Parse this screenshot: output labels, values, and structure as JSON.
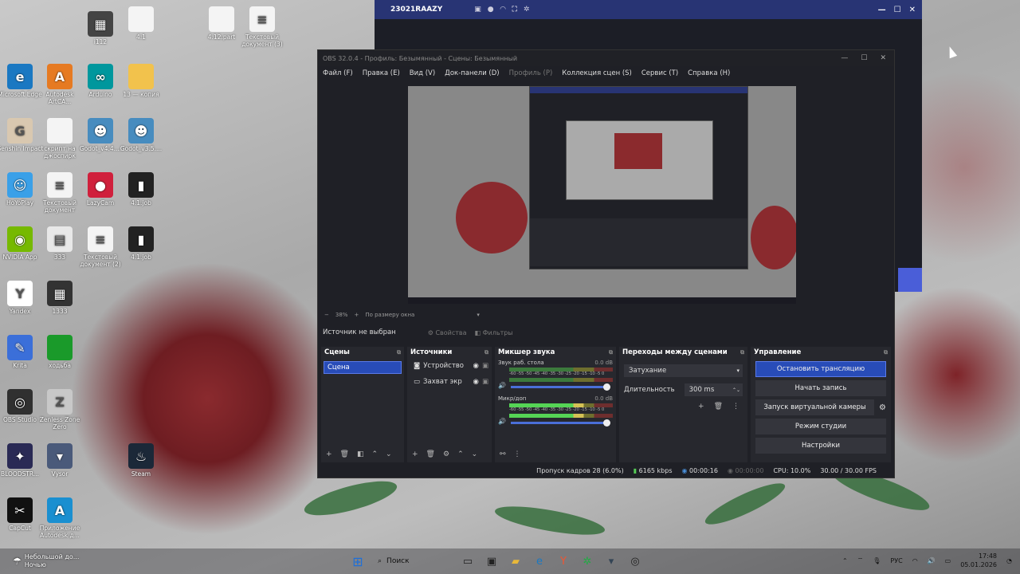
{
  "desktop_icons": [
    {
      "label": "i112",
      "icon": "app-icon",
      "color": "#444444",
      "glyph": "▦"
    },
    {
      "label": "4.1",
      "icon": "file-icon",
      "color": "#f4f4f4",
      "glyph": ""
    },
    {
      "label": "4.12.part",
      "icon": "file-icon",
      "color": "#f4f4f4",
      "glyph": ""
    },
    {
      "label": "Текстовый документ (3)",
      "icon": "text-file-icon",
      "color": "#f4f4f4",
      "glyph": "≡"
    },
    {
      "label": "Microsoft Edge",
      "icon": "edge-icon",
      "color": "#1a78c2",
      "glyph": "e"
    },
    {
      "label": "Autodesk ArtCA...",
      "icon": "autodesk-icon",
      "color": "#e67a22",
      "glyph": "A"
    },
    {
      "label": "Arduino",
      "icon": "arduino-icon",
      "color": "#00979d",
      "glyph": "∞"
    },
    {
      "label": "13 — копия",
      "icon": "folder-icon",
      "color": "#f2c24c",
      "glyph": ""
    },
    {
      "label": "Genshin Impact",
      "icon": "genshin-icon",
      "color": "#d9c8b0",
      "glyph": "G"
    },
    {
      "label": "скрипт на джоспирк",
      "icon": "file-icon",
      "color": "#f4f4f4",
      "glyph": ""
    },
    {
      "label": "Godot_v4.4....",
      "icon": "godot-icon",
      "color": "#478cbf",
      "glyph": "☻"
    },
    {
      "label": "Godot_v3.5....",
      "icon": "godot-icon",
      "color": "#478cbf",
      "glyph": "☻"
    },
    {
      "label": "HoYoPlay",
      "icon": "hoyoplay-icon",
      "color": "#3aa0e8",
      "glyph": "☺"
    },
    {
      "label": "Текстовый документ",
      "icon": "text-file-icon",
      "color": "#f4f4f4",
      "glyph": "≡"
    },
    {
      "label": "LazyCam",
      "icon": "lazycam-icon",
      "color": "#d0203c",
      "glyph": "●"
    },
    {
      "label": "4.1.job",
      "icon": "job-icon",
      "color": "#222222",
      "glyph": "▮"
    },
    {
      "label": "NVIDIA App",
      "icon": "nvidia-icon",
      "color": "#76b900",
      "glyph": "◉"
    },
    {
      "label": "333",
      "icon": "image-icon",
      "color": "#e8e8e8",
      "glyph": "▤"
    },
    {
      "label": "Текстовый документ (2)",
      "icon": "text-file-icon",
      "color": "#f4f4f4",
      "glyph": "≡"
    },
    {
      "label": "4.1.job",
      "icon": "job-icon",
      "color": "#222222",
      "glyph": "▮"
    },
    {
      "label": "Yandex",
      "icon": "yandex-icon",
      "color": "#ffffff",
      "glyph": "Y"
    },
    {
      "label": "1333",
      "icon": "image-icon",
      "color": "#333333",
      "glyph": "▦"
    },
    {
      "label": "Krita",
      "icon": "krita-icon",
      "color": "#3b6fd9",
      "glyph": "✎"
    },
    {
      "label": "ходьба",
      "icon": "image-icon",
      "color": "#1a9a2a",
      "glyph": ""
    },
    {
      "label": "OBS Studio",
      "icon": "obs-icon",
      "color": "#303030",
      "glyph": "◎"
    },
    {
      "label": "Zenless Zone Zero",
      "icon": "zzz-icon",
      "color": "#c8c8c8",
      "glyph": "Z"
    },
    {
      "label": "BLOODSTR...",
      "icon": "game-icon",
      "color": "#2a2a55",
      "glyph": "✦"
    },
    {
      "label": "Vysor",
      "icon": "vysor-icon",
      "color": "#4a5a7a",
      "glyph": "▾"
    },
    {
      "label": "Steam",
      "icon": "steam-icon",
      "color": "#1b2838",
      "glyph": "♨"
    },
    {
      "label": "CapCut",
      "icon": "capcut-icon",
      "color": "#111111",
      "glyph": "✂"
    },
    {
      "label": "Приложение Autodesk д...",
      "icon": "autodesk-icon",
      "color": "#1a8fd0",
      "glyph": "A"
    }
  ],
  "back_window": {
    "title": "23021RAAZY",
    "accent": "#283474"
  },
  "obs": {
    "title": "OBS 32.0.4 - Профиль: Безымянный - Сцены: Безымянный",
    "menu": [
      "Файл (F)",
      "Правка (E)",
      "Вид (V)",
      "Док-панели (D)",
      "Профиль (P)",
      "Коллекция сцен (S)",
      "Сервис (T)",
      "Справка (H)"
    ],
    "zoom": "38%",
    "fit_label": "По размеру окна",
    "no_source": "Источник не выбран",
    "properties_btn": "Свойства",
    "filters_btn": "Фильтры",
    "scenes": {
      "title": "Сцены",
      "items": [
        "Сцена"
      ]
    },
    "sources": {
      "title": "Источники",
      "items": [
        "Устройство",
        "Захват экр"
      ]
    },
    "mixer": {
      "title": "Микшер звука",
      "channels": [
        {
          "name": "Звук раб. стола",
          "db": "0.0 dB",
          "level": 0.0
        },
        {
          "name": "Микр/доп",
          "db": "0.0 dB",
          "level": 0.7
        }
      ],
      "ticks": "-60 -55 -50 -45 -40 -35 -30 -25 -20 -15 -10 -5 0"
    },
    "transitions": {
      "title": "Переходы между сценами",
      "selected": "Затухание",
      "duration_label": "Длительность",
      "duration": "300 ms"
    },
    "controls": {
      "title": "Управление",
      "stop_stream": "Остановить трансляцию",
      "start_record": "Начать запись",
      "virtual_cam": "Запуск виртуальной камеры",
      "studio_mode": "Режим студии",
      "settings": "Настройки"
    },
    "status": {
      "dropped": "Пропуск кадров 28 (6.0%)",
      "bitrate": "6165 kbps",
      "stream_time": "00:00:16",
      "rec_time": "00:00:00",
      "cpu": "CPU: 10.0%",
      "fps": "30.00 / 30.00 FPS"
    }
  },
  "taskbar": {
    "weather_title": "Небольшой до...",
    "weather_sub": "Ночью",
    "search_placeholder": "Поиск",
    "lang": "РУС",
    "time": "17:48",
    "date": "05.01.2026"
  }
}
